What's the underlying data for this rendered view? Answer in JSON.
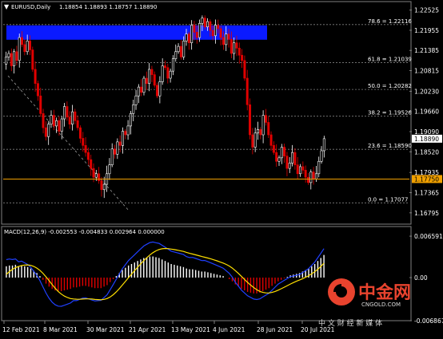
{
  "header": {
    "symbol": "EURUSD,Daily",
    "ohlc": "1.18854 1.18893 1.18757 1.18890"
  },
  "macd": {
    "label": "MACD(12,26,9) -0.002553 -0.004833 0.002964 0.000000"
  },
  "watermark": {
    "brand": "中金网",
    "domain": "CNGOLD.COM",
    "tagline": "中 文 财 经 新 媒 体",
    "colors": {
      "red": "#e8432e",
      "text": "#d9d9d9"
    }
  },
  "colors": {
    "background": "#000000",
    "bull_candle": "#ffffff",
    "bear_candle": "#e00000",
    "fib_line": "#808080",
    "blue_zone": "#0a1aff",
    "current_price_bg": "#ffffff",
    "support_line": "#f0a000",
    "macd_main": "#2040ff",
    "macd_signal": "#ffe000"
  },
  "chart_data": [
    {
      "type": "candlestick",
      "title": "EURUSD,Daily",
      "ylim": [
        1.1652,
        1.2272
      ],
      "y_ticks": [
        "1.22525",
        "1.21955",
        "1.21385",
        "1.20815",
        "1.20230",
        "1.19660",
        "1.19090",
        "1.18520",
        "1.17935",
        "1.17365",
        "1.16795"
      ],
      "x_ticks": [
        "12 Feb 2021",
        "8 Mar 2021",
        "30 Mar 2021",
        "21 Apr 2021",
        "13 May 2021",
        "4 Jun 2021",
        "28 Jun 2021",
        "20 Jul 2021"
      ],
      "current_price": "1.18890",
      "support_price": "1.17750",
      "fibonacci": [
        {
          "label": "78.6 = 1.22116",
          "value": 1.22116
        },
        {
          "label": "61.8 = 1.21039",
          "value": 1.21039
        },
        {
          "label": "50.0 = 1.20282",
          "value": 1.20282
        },
        {
          "label": "38.2 = 1.19526",
          "value": 1.19526
        },
        {
          "label": "23.6 = 1.18590",
          "value": 1.1859
        },
        {
          "label": "0.0 = 1.17077",
          "value": 1.17077
        }
      ],
      "resistance_zone": [
        1.218,
        1.2198
      ],
      "closes": [
        1.212,
        1.213,
        1.2095,
        1.2135,
        1.211,
        1.2175,
        1.2155,
        1.2135,
        1.2165,
        1.214,
        1.2085,
        1.2045,
        1.201,
        1.196,
        1.192,
        1.1895,
        1.193,
        1.1955,
        1.1925,
        1.194,
        1.191,
        1.1945,
        1.198,
        1.195,
        1.193,
        1.1965,
        1.194,
        1.192,
        1.189,
        1.187,
        1.185,
        1.183,
        1.1805,
        1.178,
        1.179,
        1.177,
        1.1745,
        1.176,
        1.179,
        1.1815,
        1.186,
        1.1845,
        1.188,
        1.187,
        1.191,
        1.19,
        1.1925,
        1.196,
        1.1985,
        1.201,
        1.2035,
        1.202,
        1.206,
        1.2045,
        1.2085,
        1.207,
        1.204,
        1.201,
        1.205,
        1.2095,
        1.209,
        1.206,
        1.208,
        1.2115,
        1.2135,
        1.215,
        1.212,
        1.2165,
        1.2185,
        1.216,
        1.221,
        1.219,
        1.2175,
        1.2215,
        1.223,
        1.2205,
        1.222,
        1.2195,
        1.218,
        1.221,
        1.22,
        1.2175,
        1.2155,
        1.2185,
        1.217,
        1.213,
        1.216,
        1.2145,
        1.2125,
        1.211,
        1.206,
        1.1985,
        1.19,
        1.1865,
        1.1905,
        1.1915,
        1.19,
        1.1955,
        1.1935,
        1.19,
        1.187,
        1.185,
        1.1825,
        1.1835,
        1.1865,
        1.184,
        1.1805,
        1.182,
        1.185,
        1.1815,
        1.179,
        1.181,
        1.18,
        1.178,
        1.1765,
        1.1795,
        1.1775,
        1.179,
        1.1825,
        1.1855,
        1.1889
      ],
      "macd_hist": [
        0.0015,
        0.0016,
        0.0016,
        0.0017,
        0.0015,
        0.0016,
        0.0015,
        0.0014,
        0.0012,
        0.0009,
        0.0006,
        0.0002,
        -0.0003,
        -0.0008,
        -0.0012,
        -0.0015,
        -0.0017,
        -0.0018,
        -0.0018,
        -0.0017,
        -0.0016,
        -0.0015,
        -0.0013,
        -0.0013,
        -0.0012,
        -0.0011,
        -0.0011,
        -0.0012,
        -0.0013,
        -0.0014,
        -0.0014,
        -0.0014,
        -0.0012,
        -0.001,
        -0.0006,
        -0.0002,
        0.0002,
        0.0006,
        0.001,
        0.0013,
        0.0016,
        0.0018,
        0.002,
        0.0022,
        0.0024,
        0.0026,
        0.0027,
        0.0028,
        0.0028,
        0.0027,
        0.0026,
        0.0024,
        0.0022,
        0.002,
        0.0018,
        0.0017,
        0.0016,
        0.0015,
        0.0014,
        0.0012,
        0.0011,
        0.0011,
        0.001,
        0.0009,
        0.0008,
        0.0008,
        0.0007,
        0.0006,
        0.0005,
        0.0004,
        0.0003,
        0.0002,
        0.0,
        -0.0002,
        -0.0005,
        -0.0009,
        -0.0012,
        -0.0015,
        -0.0017,
        -0.0019,
        -0.002,
        -0.0021,
        -0.0021,
        -0.002,
        -0.0018,
        -0.0016,
        -0.0014,
        -0.0011,
        -0.0008,
        -0.0005,
        -0.0003,
        -0.0001,
        0.0001,
        0.0003,
        0.0004,
        0.0005,
        0.0006,
        0.0008,
        0.001,
        0.0012,
        0.0015,
        0.0018,
        0.0022,
        0.0026,
        0.003
      ],
      "macd_ylim": [
        -0.0066,
        0.0066
      ],
      "macd_y_ticks": [
        "0.006591",
        "0.00",
        "-0.006867"
      ]
    }
  ]
}
